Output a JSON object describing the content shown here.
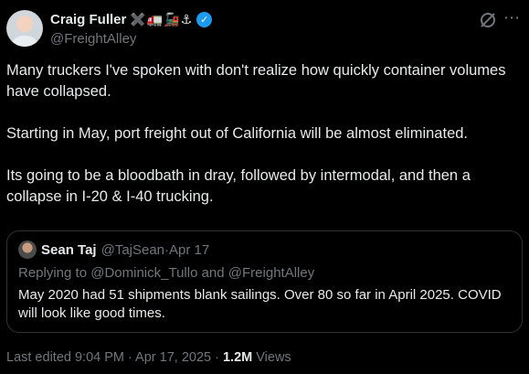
{
  "author": {
    "display_name": "Craig Fuller",
    "emoji": "✖️🚛🚂⚓",
    "verified_mark": "✓",
    "handle": "@FreightAlley"
  },
  "icons": {
    "grok": "grok-icon",
    "more": "more-icon",
    "more_glyph": "⋯"
  },
  "post": {
    "paragraphs": [
      "Many truckers I've spoken with don't realize how quickly container volumes have collapsed.",
      "Starting in May, port freight out of California will be almost eliminated.",
      "Its going to be a bloodbath in dray, followed by intermodal, and then a collapse in I-20 & I-40 trucking."
    ]
  },
  "quote": {
    "name": "Sean Taj",
    "handle": "@TajSean",
    "separator": " · ",
    "date": "Apr 17",
    "reply_prefix": "Replying to ",
    "reply_user1": "@Dominick_Tullo",
    "reply_and": " and ",
    "reply_user2": "@FreightAlley",
    "text": "May 2020 had 51 shipments blank sailings. Over 80 so far in April 2025. COVID will look like good times."
  },
  "footer": {
    "edited": "Last edited 9:04 PM · Apr 17, 2025 · ",
    "views_count": "1.2M",
    "views_label": " Views"
  },
  "colors": {
    "background": "#000000",
    "text": "#e7e9ea",
    "muted": "#71767b",
    "verified": "#1d9bf0",
    "border": "#2f3336"
  }
}
